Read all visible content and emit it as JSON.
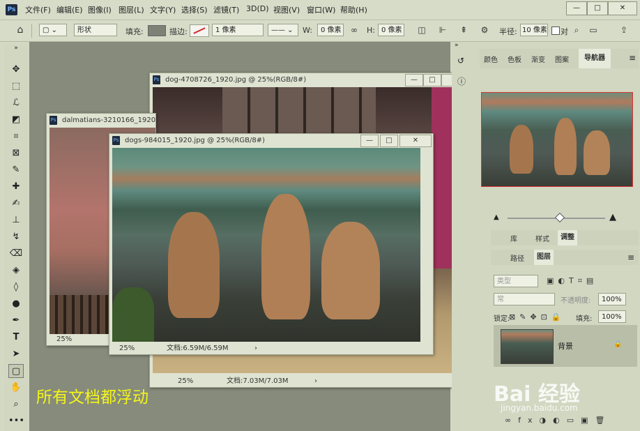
{
  "app": {
    "logo": "Ps"
  },
  "menu": [
    "文件(F)",
    "编辑(E)",
    "图像(I)",
    "图层(L)",
    "文字(Y)",
    "选择(S)",
    "滤镜(T)",
    "3D(D)",
    "视图(V)",
    "窗口(W)",
    "帮助(H)"
  ],
  "window_controls": {
    "minimize": "—",
    "restore": "□",
    "close": "✕"
  },
  "options": {
    "mode": "形状",
    "fill_label": "填充:",
    "stroke_label": "描边:",
    "stroke_width": "1 像素",
    "w_label": "W:",
    "w_value": "0 像素",
    "h_label": "H:",
    "h_value": "0 像素",
    "radius_label": "半径:",
    "radius_value": "10 像素",
    "align_edges": "对"
  },
  "docs": {
    "back": {
      "title": "dog-4708726_1920.jpg @ 25%(RGB/8#)",
      "zoom": "25%",
      "info": "文档:7.03M/7.03M"
    },
    "left": {
      "title": "dalmatians-3210166_1920",
      "zoom": "25%",
      "info": ""
    },
    "front": {
      "title": "dogs-984015_1920.jpg @ 25%(RGB/8#)",
      "zoom": "25%",
      "info": "文档:6.59M/6.59M"
    }
  },
  "panels": {
    "top_tabs": [
      "颜色",
      "色板",
      "渐变",
      "图案",
      "导航器"
    ],
    "mid_tabs": [
      "库",
      "样式",
      "调整"
    ],
    "layer_tabs": [
      "路径",
      "图层"
    ],
    "layer_kind": "类型",
    "blend_mode": "常",
    "opacity_label": "不透明度:",
    "opacity_value": "100%",
    "lock_label": "锁定:",
    "fill_label": "填充:",
    "fill_value": "100%",
    "layer_name": "背景"
  },
  "caption": "所有文档都浮动",
  "watermark": {
    "brand": "Bai 经验",
    "url": "jingyan.baidu.com"
  }
}
